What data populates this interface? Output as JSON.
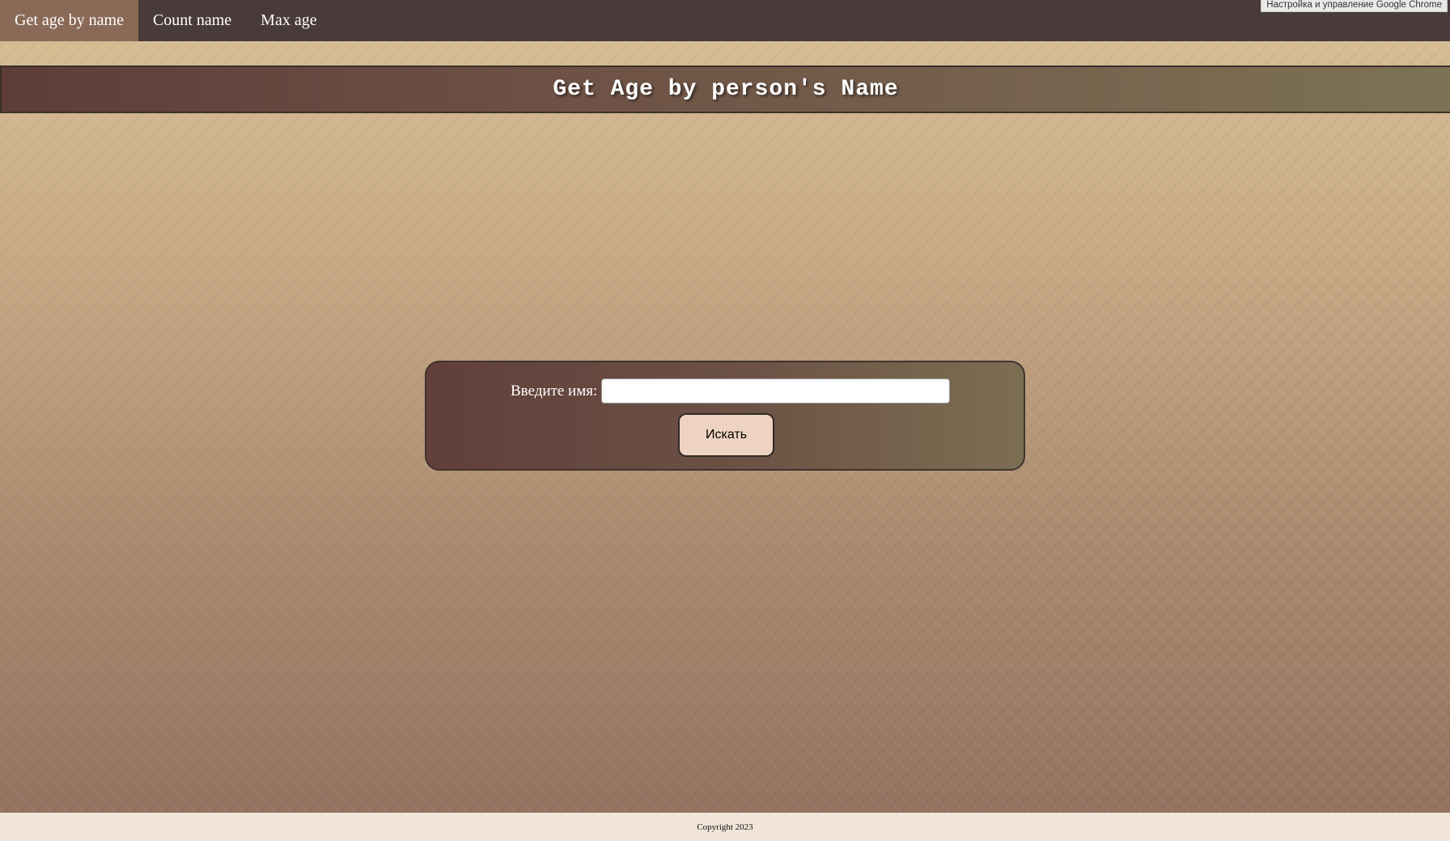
{
  "nav": {
    "items": [
      {
        "label": "Get age by name",
        "active": true
      },
      {
        "label": "Count name",
        "active": false
      },
      {
        "label": "Max age",
        "active": false
      }
    ]
  },
  "browser": {
    "banner_text": "Настройка и управление Google Chrome"
  },
  "header": {
    "title": "Get Age by person's Name"
  },
  "form": {
    "name_label": "Введите имя:",
    "name_value": "",
    "search_button_label": "Искать"
  },
  "footer": {
    "copyright": "Copyright 2023"
  },
  "colors": {
    "nav_background": "#483b39",
    "nav_active": "#8a6a57",
    "button_background": "#efd3c2",
    "footer_background": "#f1e5d9"
  }
}
